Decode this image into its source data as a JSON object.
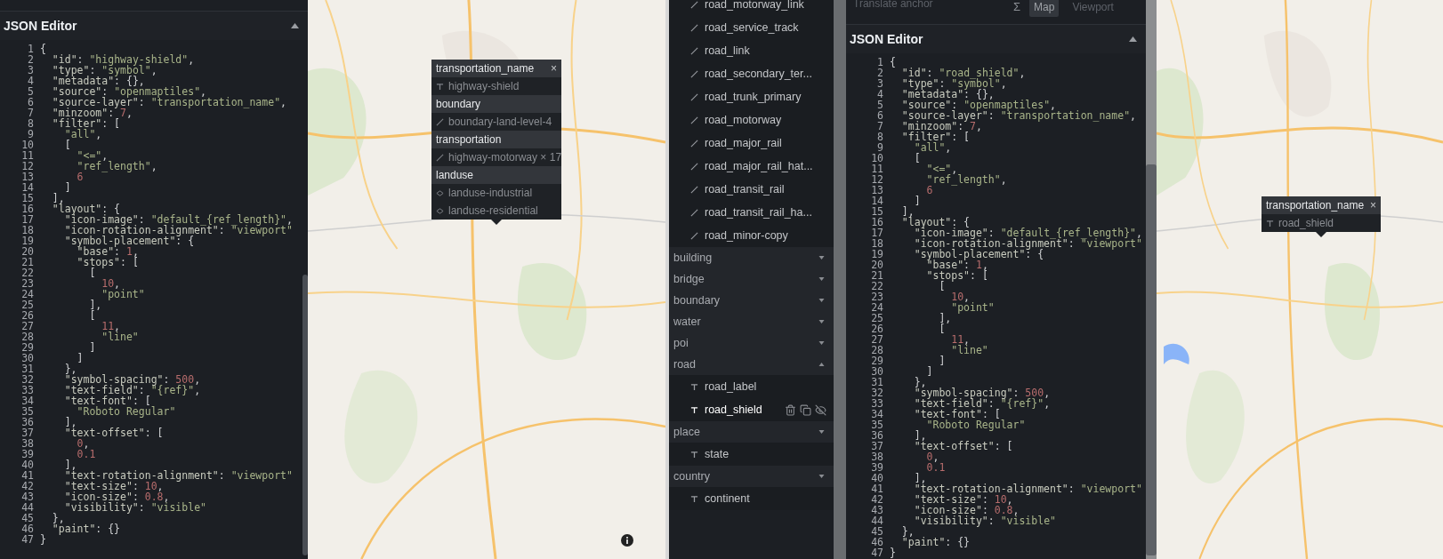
{
  "left_editor": {
    "title": "JSON Editor",
    "lines": [
      {
        "number": "1",
        "code": "{"
      },
      {
        "number": "2",
        "code": "  \"id\": \"highway-shield\","
      },
      {
        "number": "3",
        "code": "  \"type\": \"symbol\","
      },
      {
        "number": "4",
        "code": "  \"metadata\": {},"
      },
      {
        "number": "5",
        "code": "  \"source\": \"openmaptiles\","
      },
      {
        "number": "6",
        "code": "  \"source-layer\": \"transportation_name\","
      },
      {
        "number": "7",
        "code": "  \"minzoom\": 7,"
      },
      {
        "number": "8",
        "code": "  \"filter\": ["
      },
      {
        "number": "9",
        "code": "    \"all\","
      },
      {
        "number": "10",
        "code": "    ["
      },
      {
        "number": "11",
        "code": "      \"<=\","
      },
      {
        "number": "12",
        "code": "      \"ref_length\","
      },
      {
        "number": "13",
        "code": "      6"
      },
      {
        "number": "14",
        "code": "    ]"
      },
      {
        "number": "15",
        "code": "  ],"
      },
      {
        "number": "16",
        "code": "  \"layout\": {"
      },
      {
        "number": "17",
        "code": "    \"icon-image\": \"default_{ref_length}\","
      },
      {
        "number": "18",
        "code": "    \"icon-rotation-alignment\": \"viewport\""
      },
      {
        "number": "19",
        "code": "    \"symbol-placement\": {"
      },
      {
        "number": "20",
        "code": "      \"base\": 1,"
      },
      {
        "number": "21",
        "code": "      \"stops\": ["
      },
      {
        "number": "22",
        "code": "        ["
      },
      {
        "number": "23",
        "code": "          10,"
      },
      {
        "number": "24",
        "code": "          \"point\""
      },
      {
        "number": "25",
        "code": "        ],"
      },
      {
        "number": "26",
        "code": "        ["
      },
      {
        "number": "27",
        "code": "          11,"
      },
      {
        "number": "28",
        "code": "          \"line\""
      },
      {
        "number": "29",
        "code": "        ]"
      },
      {
        "number": "30",
        "code": "      ]"
      },
      {
        "number": "31",
        "code": "    },"
      },
      {
        "number": "32",
        "code": "    \"symbol-spacing\": 500,"
      },
      {
        "number": "33",
        "code": "    \"text-field\": \"{ref}\","
      },
      {
        "number": "34",
        "code": "    \"text-font\": ["
      },
      {
        "number": "35",
        "code": "      \"Roboto Regular\""
      },
      {
        "number": "36",
        "code": "    ],"
      },
      {
        "number": "37",
        "code": "    \"text-offset\": ["
      },
      {
        "number": "38",
        "code": "      0,"
      },
      {
        "number": "39",
        "code": "      0.1"
      },
      {
        "number": "40",
        "code": "    ],"
      },
      {
        "number": "41",
        "code": "    \"text-rotation-alignment\": \"viewport\""
      },
      {
        "number": "42",
        "code": "    \"text-size\": 10,"
      },
      {
        "number": "43",
        "code": "    \"icon-size\": 0.8,"
      },
      {
        "number": "44",
        "code": "    \"visibility\": \"visible\""
      },
      {
        "number": "45",
        "code": "  },"
      },
      {
        "number": "46",
        "code": "  \"paint\": {}"
      },
      {
        "number": "47",
        "code": "}"
      }
    ]
  },
  "left_map": {
    "kind": "picture",
    "popup": {
      "close": "×",
      "sections": [
        {
          "source_layer": "transportation_name",
          "layers": [
            {
              "kind": "symbol",
              "name": "highway-shield"
            }
          ]
        },
        {
          "source_layer": "boundary",
          "layers": [
            {
              "kind": "line",
              "name": "boundary-land-level-4"
            }
          ]
        },
        {
          "source_layer": "transportation",
          "layers": [
            {
              "kind": "line",
              "name": "highway-motorway × 17"
            }
          ]
        },
        {
          "source_layer": "landuse",
          "layers": [
            {
              "kind": "fill",
              "name": "landuse-industrial"
            },
            {
              "kind": "fill",
              "name": "landuse-residential"
            }
          ]
        }
      ]
    }
  },
  "layer_list": [
    {
      "kind": "line",
      "name": "road_motorway_link",
      "selected": false
    },
    {
      "kind": "line",
      "name": "road_service_track",
      "selected": false
    },
    {
      "kind": "line",
      "name": "road_link",
      "selected": false
    },
    {
      "kind": "line",
      "name": "road_secondary_ter...",
      "selected": false
    },
    {
      "kind": "line",
      "name": "road_trunk_primary",
      "selected": false
    },
    {
      "kind": "line",
      "name": "road_motorway",
      "selected": false
    },
    {
      "kind": "line",
      "name": "road_major_rail",
      "selected": false
    },
    {
      "kind": "line",
      "name": "road_major_rail_hat...",
      "selected": false
    },
    {
      "kind": "line",
      "name": "road_transit_rail",
      "selected": false
    },
    {
      "kind": "line",
      "name": "road_transit_rail_ha...",
      "selected": false
    },
    {
      "kind": "line",
      "name": "road_minor-copy",
      "selected": false
    },
    {
      "kind": "group",
      "name": "building",
      "expanded": false
    },
    {
      "kind": "group",
      "name": "bridge",
      "expanded": false
    },
    {
      "kind": "group",
      "name": "boundary",
      "expanded": false
    },
    {
      "kind": "group",
      "name": "water",
      "expanded": false
    },
    {
      "kind": "group",
      "name": "poi",
      "expanded": false
    },
    {
      "kind": "group",
      "name": "road",
      "expanded": true
    },
    {
      "kind": "symbol",
      "name": "road_label",
      "selected": false
    },
    {
      "kind": "symbol",
      "name": "road_shield",
      "selected": true
    },
    {
      "kind": "group",
      "name": "place",
      "expanded": false
    },
    {
      "kind": "symbol",
      "name": "state",
      "selected": false
    },
    {
      "kind": "group",
      "name": "country",
      "expanded": false
    },
    {
      "kind": "symbol",
      "name": "continent",
      "selected": false
    }
  ],
  "right_editor": {
    "toolbar": {
      "label": "Translate anchor",
      "sigma": "Σ",
      "options": [
        {
          "label": "Map",
          "selected": true
        },
        {
          "label": "Viewport",
          "selected": false
        }
      ]
    },
    "title": "JSON Editor",
    "lines": [
      {
        "number": "1",
        "code": "{"
      },
      {
        "number": "2",
        "code": "  \"id\": \"road_shield\","
      },
      {
        "number": "3",
        "code": "  \"type\": \"symbol\","
      },
      {
        "number": "4",
        "code": "  \"metadata\": {},"
      },
      {
        "number": "5",
        "code": "  \"source\": \"openmaptiles\","
      },
      {
        "number": "6",
        "code": "  \"source-layer\": \"transportation_name\","
      },
      {
        "number": "7",
        "code": "  \"minzoom\": 7,"
      },
      {
        "number": "8",
        "code": "  \"filter\": ["
      },
      {
        "number": "9",
        "code": "    \"all\","
      },
      {
        "number": "10",
        "code": "    ["
      },
      {
        "number": "11",
        "code": "      \"<=\","
      },
      {
        "number": "12",
        "code": "      \"ref_length\","
      },
      {
        "number": "13",
        "code": "      6"
      },
      {
        "number": "14",
        "code": "    ]"
      },
      {
        "number": "15",
        "code": "  ],"
      },
      {
        "number": "16",
        "code": "  \"layout\": {"
      },
      {
        "number": "17",
        "code": "    \"icon-image\": \"default_{ref_length}\","
      },
      {
        "number": "18",
        "code": "    \"icon-rotation-alignment\": \"viewport\""
      },
      {
        "number": "19",
        "code": "    \"symbol-placement\": {"
      },
      {
        "number": "20",
        "code": "      \"base\": 1,"
      },
      {
        "number": "21",
        "code": "      \"stops\": ["
      },
      {
        "number": "22",
        "code": "        ["
      },
      {
        "number": "23",
        "code": "          10,"
      },
      {
        "number": "24",
        "code": "          \"point\""
      },
      {
        "number": "25",
        "code": "        ],"
      },
      {
        "number": "26",
        "code": "        ["
      },
      {
        "number": "27",
        "code": "          11,"
      },
      {
        "number": "28",
        "code": "          \"line\""
      },
      {
        "number": "29",
        "code": "        ]"
      },
      {
        "number": "30",
        "code": "      ]"
      },
      {
        "number": "31",
        "code": "    },"
      },
      {
        "number": "32",
        "code": "    \"symbol-spacing\": 500,"
      },
      {
        "number": "33",
        "code": "    \"text-field\": \"{ref}\","
      },
      {
        "number": "34",
        "code": "    \"text-font\": ["
      },
      {
        "number": "35",
        "code": "      \"Roboto Regular\""
      },
      {
        "number": "36",
        "code": "    ],"
      },
      {
        "number": "37",
        "code": "    \"text-offset\": ["
      },
      {
        "number": "38",
        "code": "      0,"
      },
      {
        "number": "39",
        "code": "      0.1"
      },
      {
        "number": "40",
        "code": "    ],"
      },
      {
        "number": "41",
        "code": "    \"text-rotation-alignment\": \"viewport\""
      },
      {
        "number": "42",
        "code": "    \"text-size\": 10,"
      },
      {
        "number": "43",
        "code": "    \"icon-size\": 0.8,"
      },
      {
        "number": "44",
        "code": "    \"visibility\": \"visible\""
      },
      {
        "number": "45",
        "code": "  },"
      },
      {
        "number": "46",
        "code": "  \"paint\": {}"
      },
      {
        "number": "47",
        "code": "}"
      }
    ]
  },
  "right_map": {
    "kind": "picture",
    "popup": {
      "close": "×",
      "sections": [
        {
          "source_layer": "transportation_name",
          "layers": [
            {
              "kind": "symbol",
              "name": "road_shield"
            }
          ]
        }
      ]
    }
  }
}
